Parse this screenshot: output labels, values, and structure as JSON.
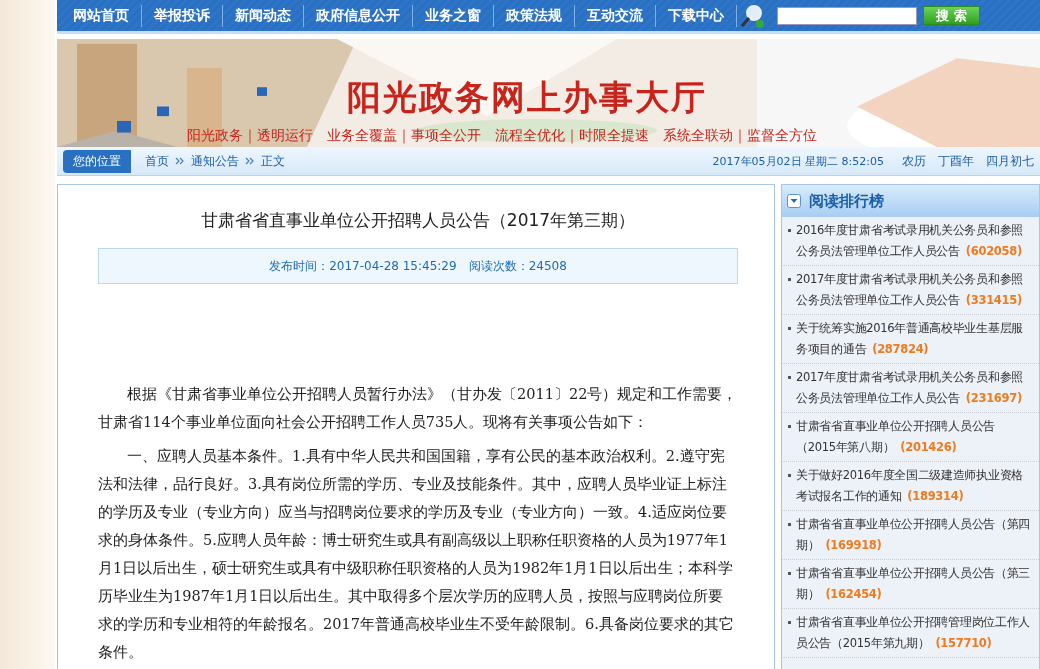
{
  "nav": {
    "items": [
      "网站首页",
      "举报投诉",
      "新闻动态",
      "政府信息公开",
      "业务之窗",
      "政策法规",
      "互动交流",
      "下载中心"
    ]
  },
  "search": {
    "button": "搜 索"
  },
  "banner": {
    "title": "阳光政务网上办事大厅",
    "slogan": "阳光政务｜透明运行　业务全覆盖｜事项全公开　流程全优化｜时限全提速　系统全联动｜监督全方位"
  },
  "breadcrumb": {
    "label": "您的位置",
    "items": [
      "首页",
      "通知公告",
      "正文"
    ],
    "date": "2017年05月02日 星期二 8:52:05",
    "lunar": "农历　丁酉年　四月初七"
  },
  "article": {
    "title": "甘肃省省直事业单位公开招聘人员公告（2017年第三期）",
    "published": "发布时间：2017-04-28 15:45:29",
    "reads": "阅读次数：24508",
    "paragraphs": [
      "根据《甘肃省事业单位公开招聘人员暂行办法》（甘办发〔2011〕22号）规定和工作需要，甘肃省114个事业单位面向社会公开招聘工作人员735人。现将有关事项公告如下：",
      "一、应聘人员基本条件。1.具有中华人民共和国国籍，享有公民的基本政治权利。2.遵守宪法和法律，品行良好。3.具有岗位所需的学历、专业及技能条件。其中，应聘人员毕业证上标注的学历及专业（专业方向）应当与招聘岗位要求的学历及专业（专业方向）一致。4.适应岗位要求的身体条件。5.应聘人员年龄：博士研究生或具有副高级以上职称任职资格的人员为1977年1月1日以后出生，硕士研究生或具有中级职称任职资格的人员为1982年1月1日以后出生；本科学历毕业生为1987年1月1日以后出生。其中取得多个层次学历的应聘人员，按照与应聘岗位所要求的学历和专业相符的年龄报名。2017年普通高校毕业生不受年龄限制。6.具备岗位要求的其它条件。"
    ]
  },
  "sidebar": {
    "title": "阅读排行榜",
    "items": [
      {
        "text": "2016年度甘肃省考试录用机关公务员和参照公务员法管理单位工作人员公告",
        "count": "(602058)"
      },
      {
        "text": "2017年度甘肃省考试录用机关公务员和参照公务员法管理单位工作人员公告",
        "count": "(331415)"
      },
      {
        "text": "关于统筹实施2016年普通高校毕业生基层服务项目的通告",
        "count": "(287824)"
      },
      {
        "text": "2017年度甘肃省考试录用机关公务员和参照公务员法管理单位工作人员公告",
        "count": "(231697)"
      },
      {
        "text": "甘肃省省直事业单位公开招聘人员公告（2015年第八期）",
        "count": "(201426)"
      },
      {
        "text": "关于做好2016年度全国二级建造师执业资格考试报名工作的通知",
        "count": "(189314)"
      },
      {
        "text": "甘肃省省直事业单位公开招聘人员公告（第四期）",
        "count": "(169918)"
      },
      {
        "text": "甘肃省省直事业单位公开招聘人员公告（第三期）",
        "count": "(162454)"
      },
      {
        "text": "甘肃省省直事业单位公开招聘管理岗位工作人员公告（2015年第九期）",
        "count": "(157710)"
      }
    ]
  }
}
